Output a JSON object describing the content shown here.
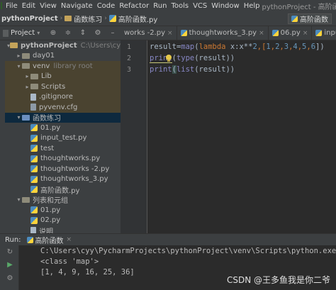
{
  "menubar": {
    "items": [
      "File",
      "Edit",
      "View",
      "Navigate",
      "Code",
      "Refactor",
      "Run",
      "Tools",
      "VCS",
      "Window",
      "Help"
    ],
    "window_title": "pythonProject - 高阶函数.py"
  },
  "navbar": {
    "project": "pythonProject",
    "folder": "函数练习",
    "file": "高阶函数.py",
    "run_config": "高阶函数"
  },
  "project_panel": {
    "label": "Project",
    "tree": [
      {
        "label": "pythonProject",
        "extra": "C:\\Users\\cyy\\Pycharm",
        "depth": 0,
        "chev": "▾",
        "icon": "folder",
        "bold": true
      },
      {
        "label": "day01",
        "extra": "",
        "depth": 1,
        "chev": "▸",
        "icon": "folder"
      },
      {
        "label": "venv",
        "extra": "library root",
        "depth": 1,
        "chev": "▾",
        "icon": "folder",
        "venv": true
      },
      {
        "label": "Lib",
        "extra": "",
        "depth": 2,
        "chev": "▸",
        "icon": "folder",
        "venv": true
      },
      {
        "label": "Scripts",
        "extra": "",
        "depth": 2,
        "chev": "▸",
        "icon": "folder",
        "venv": true
      },
      {
        "label": ".gitignore",
        "extra": "",
        "depth": 2,
        "chev": "",
        "icon": "txt",
        "venv": true
      },
      {
        "label": "pyvenv.cfg",
        "extra": "",
        "depth": 2,
        "chev": "",
        "icon": "cfg",
        "venv": true
      },
      {
        "label": "函数练习",
        "extra": "",
        "depth": 1,
        "chev": "▾",
        "icon": "folder-blue",
        "selected": true
      },
      {
        "label": "01.py",
        "extra": "",
        "depth": 2,
        "chev": "",
        "icon": "py"
      },
      {
        "label": "input_test.py",
        "extra": "",
        "depth": 2,
        "chev": "",
        "icon": "py"
      },
      {
        "label": "test",
        "extra": "",
        "depth": 2,
        "chev": "",
        "icon": "py"
      },
      {
        "label": "thoughtworks.py",
        "extra": "",
        "depth": 2,
        "chev": "",
        "icon": "py"
      },
      {
        "label": "thoughtworks -2.py",
        "extra": "",
        "depth": 2,
        "chev": "",
        "icon": "py"
      },
      {
        "label": "thoughtworks_3.py",
        "extra": "",
        "depth": 2,
        "chev": "",
        "icon": "py"
      },
      {
        "label": "高阶函数.py",
        "extra": "",
        "depth": 2,
        "chev": "",
        "icon": "py"
      },
      {
        "label": "列表和元组",
        "extra": "",
        "depth": 1,
        "chev": "▾",
        "icon": "folder"
      },
      {
        "label": "01.py",
        "extra": "",
        "depth": 2,
        "chev": "",
        "icon": "py"
      },
      {
        "label": "02.py",
        "extra": "",
        "depth": 2,
        "chev": "",
        "icon": "py"
      },
      {
        "label": "说明",
        "extra": "",
        "depth": 2,
        "chev": "",
        "icon": "txt"
      }
    ]
  },
  "tabs": [
    {
      "label": "works -2.py"
    },
    {
      "label": "thoughtworks_3.py"
    },
    {
      "label": "06.py"
    },
    {
      "label": "input_test.py"
    }
  ],
  "editor": {
    "line_numbers": [
      "1",
      "2",
      "3"
    ],
    "line1": {
      "a": "result",
      "b": "=",
      "c": "map",
      "d": "(",
      "e": "lambda",
      "f": " x:x**",
      "g": "2",
      "h": ",[",
      "i": "1",
      "j": ",",
      "k": "2",
      "l": ",",
      "m": "3",
      "n": ",",
      "o": "4",
      "p": ",",
      "q": "5",
      "r": ",",
      "s": "6",
      "t": "])"
    },
    "line2": {
      "a": "print",
      "b": "(",
      "c": "type",
      "d": "(result))"
    },
    "line3": {
      "a": "print",
      "b": "(",
      "c": "list",
      "d": "(result))"
    }
  },
  "run_panel": {
    "label": "Run:",
    "tab": "高阶函数",
    "console": [
      "C:\\Users\\cyy\\PycharmProjects\\pythonProject\\venv\\Scripts\\python.exe C:/Us",
      "<class 'map'>",
      "[1, 4, 9, 16, 25, 36]"
    ]
  },
  "watermark": "CSDN @王多鱼我是你二爷",
  "colors": {
    "background": "#2b2b2b",
    "panel": "#3c3f41",
    "selected_row": "#0d293e",
    "venv_row": "#4a4330",
    "keyword": "#cc7832",
    "builtin": "#8888c6",
    "number": "#6897bb"
  }
}
